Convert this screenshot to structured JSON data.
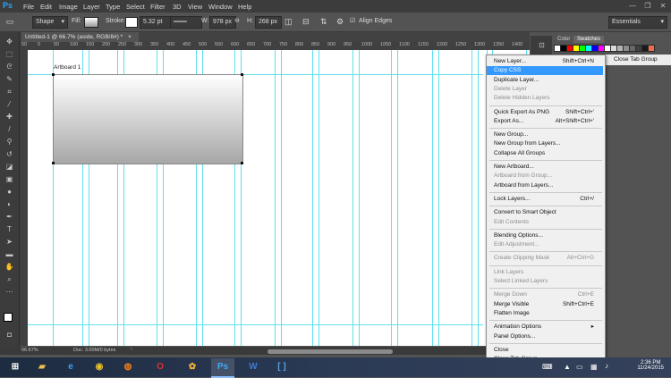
{
  "app": {
    "logo": "Ps"
  },
  "menubar": {
    "items": [
      "File",
      "Edit",
      "Image",
      "Layer",
      "Type",
      "Select",
      "Filter",
      "3D",
      "View",
      "Window",
      "Help"
    ]
  },
  "window_controls": {
    "minimize": "—",
    "restore": "❐",
    "close": "✕"
  },
  "options_bar": {
    "tool_mode": "Shape",
    "fill_label": "Fill:",
    "stroke_label": "Stroke:",
    "stroke_size": "5.32 pt",
    "w_label": "W:",
    "w_value": "978 px",
    "h_label": "H:",
    "h_value": "268 px",
    "align_edges": "Align Edges",
    "align_edges_checked": true,
    "workspace": "Essentials"
  },
  "document": {
    "tab_title": "Untitled-1 @ 66.7% (aside, RGB/8#) *",
    "close_glyph": "×",
    "artboard_label": "Artboard 1"
  },
  "ruler": {
    "ticks": [
      "50",
      "0",
      "50",
      "100",
      "150",
      "200",
      "250",
      "300",
      "350",
      "400",
      "450",
      "500",
      "550",
      "600",
      "650",
      "700",
      "750",
      "800",
      "850",
      "900",
      "950",
      "1000",
      "1050",
      "1100",
      "1150",
      "1200",
      "1250",
      "1300",
      "1350",
      "1400"
    ]
  },
  "status": {
    "zoom": "66.67%",
    "doc": "Doc: 3.00M/0 bytes"
  },
  "panel": {
    "tabs": [
      "Color",
      "Swatches"
    ],
    "active_tab": "Swatches",
    "swatches": [
      "#ffffff",
      "#000000",
      "#ff0000",
      "#ffff00",
      "#00ff00",
      "#00ffff",
      "#0000ff",
      "#ff00ff",
      "#ffffff",
      "#d9d9d9",
      "#b3b3b3",
      "#8c8c8c",
      "#666666",
      "#404040",
      "#1a1a1a",
      "#f26c4f"
    ],
    "flyout_close": "Close Tab Group"
  },
  "context_menu": {
    "items": [
      {
        "label": "New Layer...",
        "shortcut": "Shift+Ctrl+N",
        "disabled": false,
        "highlighted": false
      },
      {
        "label": "Copy CSS",
        "shortcut": "",
        "disabled": false,
        "highlighted": true
      },
      {
        "label": "Duplicate Layer...",
        "shortcut": "",
        "disabled": false,
        "highlighted": false
      },
      {
        "label": "Delete Layer",
        "shortcut": "",
        "disabled": true,
        "highlighted": false
      },
      {
        "label": "Delete Hidden Layers",
        "shortcut": "",
        "disabled": true,
        "highlighted": false,
        "sep_after": true
      },
      {
        "label": "Quick Export As PNG",
        "shortcut": "Shift+Ctrl+'",
        "disabled": false,
        "highlighted": false
      },
      {
        "label": "Export As...",
        "shortcut": "Alt+Shift+Ctrl+'",
        "disabled": false,
        "highlighted": false,
        "sep_after": true
      },
      {
        "label": "New Group...",
        "shortcut": "",
        "disabled": false,
        "highlighted": false
      },
      {
        "label": "New Group from Layers...",
        "shortcut": "",
        "disabled": false,
        "highlighted": false
      },
      {
        "label": "Collapse All Groups",
        "shortcut": "",
        "disabled": false,
        "highlighted": false,
        "sep_after": true
      },
      {
        "label": "New Artboard...",
        "shortcut": "",
        "disabled": false,
        "highlighted": false
      },
      {
        "label": "Artboard from Group...",
        "shortcut": "",
        "disabled": true,
        "highlighted": false
      },
      {
        "label": "Artboard from Layers...",
        "shortcut": "",
        "disabled": false,
        "highlighted": false,
        "sep_after": true
      },
      {
        "label": "Lock Layers...",
        "shortcut": "Ctrl+/",
        "disabled": false,
        "highlighted": false,
        "sep_after": true
      },
      {
        "label": "Convert to Smart Object",
        "shortcut": "",
        "disabled": false,
        "highlighted": false
      },
      {
        "label": "Edit Contents",
        "shortcut": "",
        "disabled": true,
        "highlighted": false,
        "sep_after": true
      },
      {
        "label": "Blending Options...",
        "shortcut": "",
        "disabled": false,
        "highlighted": false
      },
      {
        "label": "Edit Adjustment...",
        "shortcut": "",
        "disabled": true,
        "highlighted": false,
        "sep_after": true
      },
      {
        "label": "Create Clipping Mask",
        "shortcut": "Alt+Ctrl+G",
        "disabled": true,
        "highlighted": false,
        "sep_after": true
      },
      {
        "label": "Link Layers",
        "shortcut": "",
        "disabled": true,
        "highlighted": false
      },
      {
        "label": "Select Linked Layers",
        "shortcut": "",
        "disabled": true,
        "highlighted": false,
        "sep_after": true
      },
      {
        "label": "Merge Down",
        "shortcut": "Ctrl+E",
        "disabled": true,
        "highlighted": false
      },
      {
        "label": "Merge Visible",
        "shortcut": "Shift+Ctrl+E",
        "disabled": false,
        "highlighted": false
      },
      {
        "label": "Flatten Image",
        "shortcut": "",
        "disabled": false,
        "highlighted": false,
        "sep_after": true
      },
      {
        "label": "Animation Options",
        "shortcut": "",
        "disabled": false,
        "highlighted": false,
        "submenu": true
      },
      {
        "label": "Panel Options...",
        "shortcut": "",
        "disabled": false,
        "highlighted": false,
        "sep_after": true
      },
      {
        "label": "Close",
        "shortcut": "",
        "disabled": false,
        "highlighted": false
      },
      {
        "label": "Close Tab Group",
        "shortcut": "",
        "disabled": false,
        "highlighted": false
      }
    ]
  },
  "taskbar": {
    "apps": [
      {
        "name": "windows-start-icon",
        "glyph": "⊞",
        "color": "#ffffff",
        "active": false
      },
      {
        "name": "file-explorer-icon",
        "glyph": "▰",
        "color": "#f0c04a",
        "active": false
      },
      {
        "name": "internet-explorer-icon",
        "glyph": "e",
        "color": "#3aa0ff",
        "active": false
      },
      {
        "name": "chrome-icon",
        "glyph": "◉",
        "color": "#e6c02d",
        "active": false
      },
      {
        "name": "firefox-icon",
        "glyph": "◍",
        "color": "#f07b1a",
        "active": false
      },
      {
        "name": "opera-icon",
        "glyph": "O",
        "color": "#e0302f",
        "active": false
      },
      {
        "name": "flower-app-icon",
        "glyph": "✿",
        "color": "#f5b63a",
        "active": false
      },
      {
        "name": "photoshop-icon",
        "glyph": "Ps",
        "color": "#41a8f5",
        "active": true
      },
      {
        "name": "word-icon",
        "glyph": "W",
        "color": "#3f79d1",
        "active": false
      },
      {
        "name": "brackets-icon",
        "glyph": "[ ]",
        "color": "#5aa0e0",
        "active": false
      }
    ],
    "time": "2:36 PM",
    "date": "11/24/2015"
  }
}
